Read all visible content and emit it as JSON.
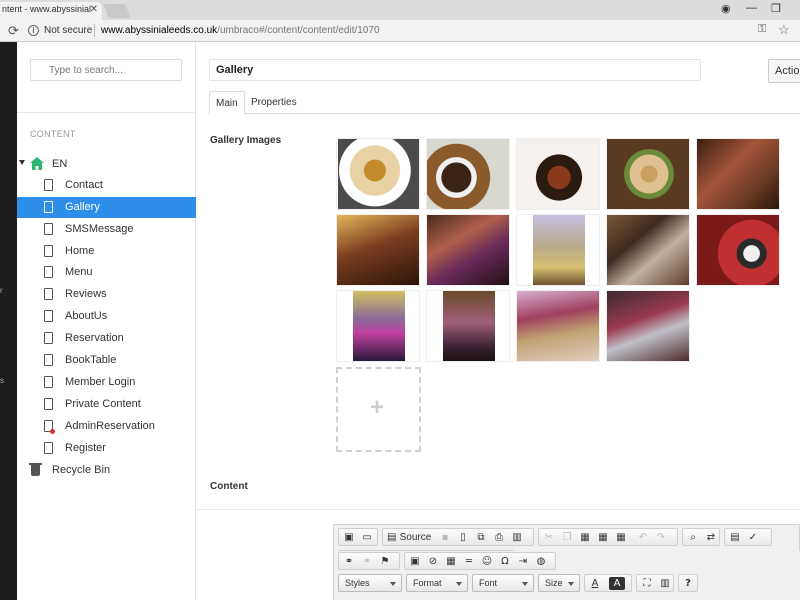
{
  "browser": {
    "tab_title": "ntent - www.abyssinial",
    "security_label": "Not secure",
    "url_host": "www.abyssinialeeds.co.uk",
    "url_path": "/umbraco#/content/content/edit/1070"
  },
  "tree": {
    "search_placeholder": "Type to search...",
    "section_label": "CONTENT",
    "root": "EN",
    "items": [
      "Contact",
      "Gallery",
      "SMSMessage",
      "Home",
      "Menu",
      "Reviews",
      "AboutUs",
      "Reservation",
      "BookTable",
      "Member Login",
      "Private Content",
      "AdminReservation",
      "Register"
    ],
    "selected": "Gallery",
    "recycle_bin": "Recycle Bin"
  },
  "editor": {
    "name": "Gallery",
    "actions_label": "Actions",
    "tabs": [
      "Main",
      "Properties"
    ],
    "active_tab": "Main",
    "gallery_label": "Gallery Images",
    "content_label": "Content",
    "add_symbol": "+"
  },
  "toolbar": {
    "source_label": "Source",
    "styles_label": "Styles",
    "format_label": "Format",
    "font_label": "Font",
    "size_label": "Size",
    "help_label": "?"
  },
  "colors": {
    "selected_node": "#2d8ee9",
    "home_icon": "#2bb673",
    "left_strip": "#1d1d1d"
  }
}
